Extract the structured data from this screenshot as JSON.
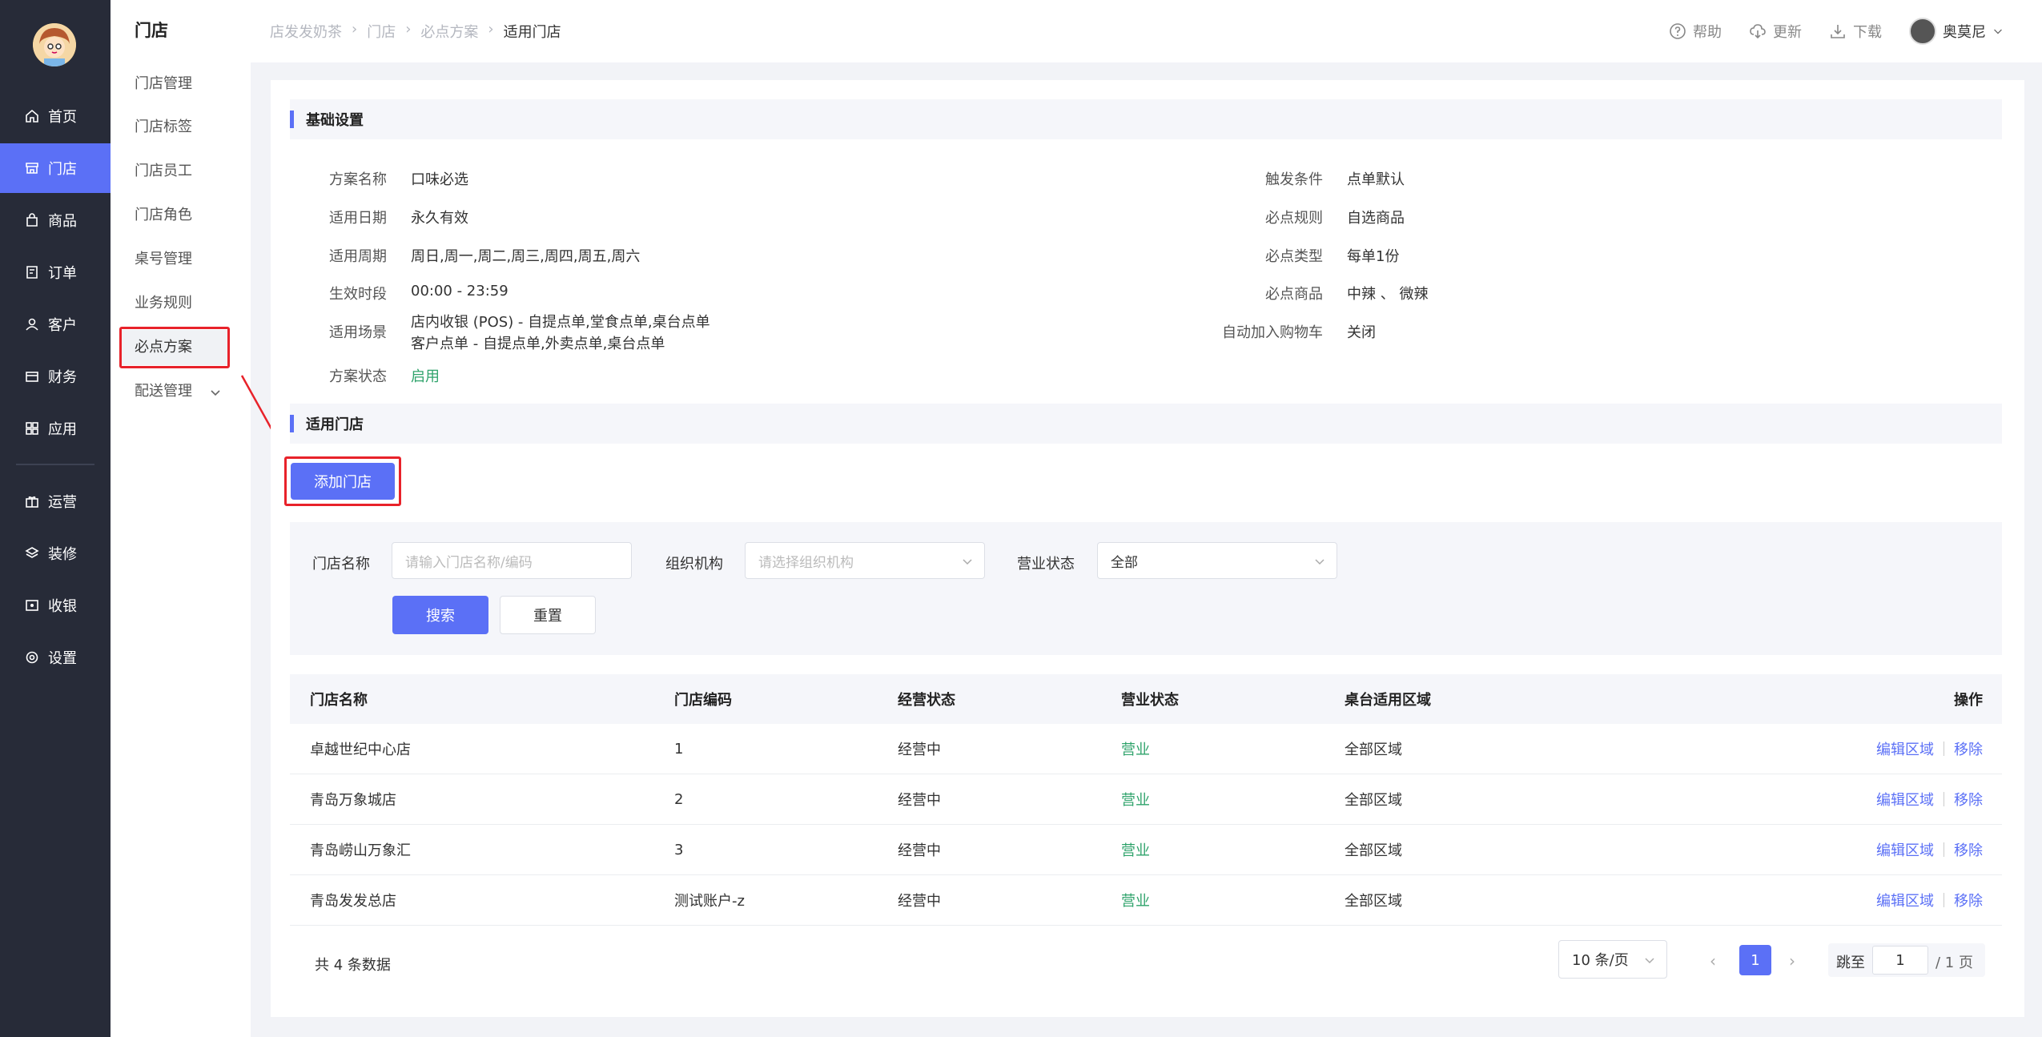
{
  "nav": {
    "items": [
      {
        "label": "首页",
        "icon": "home-icon"
      },
      {
        "label": "门店",
        "icon": "store-icon"
      },
      {
        "label": "商品",
        "icon": "bag-icon"
      },
      {
        "label": "订单",
        "icon": "order-icon"
      },
      {
        "label": "客户",
        "icon": "user-icon"
      },
      {
        "label": "财务",
        "icon": "card-icon"
      },
      {
        "label": "应用",
        "icon": "apps-icon"
      },
      {
        "label": "运营",
        "icon": "gift-icon"
      },
      {
        "label": "装修",
        "icon": "layers-icon"
      },
      {
        "label": "收银",
        "icon": "cashier-icon"
      },
      {
        "label": "设置",
        "icon": "settings-icon"
      }
    ],
    "active": "门店"
  },
  "subnav": {
    "title": "门店",
    "items": [
      "门店管理",
      "门店标签",
      "门店员工",
      "门店角色",
      "桌号管理",
      "业务规则",
      "必点方案",
      "配送管理"
    ],
    "active": "必点方案"
  },
  "header": {
    "breadcrumb": [
      "店发发奶茶",
      "门店",
      "必点方案",
      "适用门店"
    ],
    "help": "帮助",
    "update": "更新",
    "download": "下载",
    "user": "奥莫尼"
  },
  "basic": {
    "title": "基础设置",
    "left": [
      {
        "k": "方案名称",
        "v": "口味必选"
      },
      {
        "k": "适用日期",
        "v": "永久有效"
      },
      {
        "k": "适用周期",
        "v": "周日,周一,周二,周三,周四,周五,周六"
      },
      {
        "k": "生效时段",
        "v": "00:00 - 23:59"
      },
      {
        "k": "适用场景",
        "v": "店内收银 (POS) - 自提点单,堂食点单,桌台点单",
        "v2": "客户点单 - 自提点单,外卖点单,桌台点单"
      },
      {
        "k": "方案状态",
        "v": "启用"
      }
    ],
    "right": [
      {
        "k": "触发条件",
        "v": "点单默认"
      },
      {
        "k": "必点规则",
        "v": "自选商品"
      },
      {
        "k": "必点类型",
        "v": "每单1份"
      },
      {
        "k": "必点商品",
        "v": "中辣 、 微辣"
      },
      {
        "k": "自动加入购物车",
        "v": "关闭"
      }
    ]
  },
  "stores": {
    "title": "适用门店",
    "add_button": "添加门店",
    "filter": {
      "name_label": "门店名称",
      "name_placeholder": "请输入门店名称/编码",
      "org_label": "组织机构",
      "org_placeholder": "请选择组织机构",
      "status_label": "营业状态",
      "status_value": "全部",
      "search": "搜索",
      "reset": "重置"
    },
    "columns": [
      "门店名称",
      "门店编码",
      "经营状态",
      "营业状态",
      "桌台适用区域",
      "操作"
    ],
    "rows": [
      {
        "name": "卓越世纪中心店",
        "code": "1",
        "biz": "经营中",
        "open": "营业",
        "area": "全部区域"
      },
      {
        "name": "青岛万象城店",
        "code": "2",
        "biz": "经营中",
        "open": "营业",
        "area": "全部区域"
      },
      {
        "name": "青岛崂山万象汇",
        "code": "3",
        "biz": "经营中",
        "open": "营业",
        "area": "全部区域"
      },
      {
        "name": "青岛发发总店",
        "code": "测试账户-z",
        "biz": "经营中",
        "open": "营业",
        "area": "全部区域"
      }
    ],
    "op_edit": "编辑区域",
    "op_remove": "移除",
    "total": "共 4 条数据",
    "page_size": "10 条/页",
    "current_page": "1",
    "jump_label": "跳至",
    "jump_value": "1",
    "jump_total": "/ 1 页"
  },
  "colors": {
    "accent": "#5b70f6",
    "sidebar": "#272b38",
    "success": "#2fa36b",
    "callout": "#e8222a"
  }
}
